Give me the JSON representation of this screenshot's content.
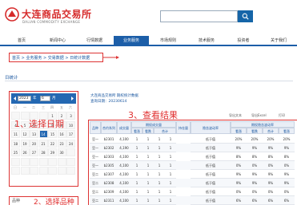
{
  "header": {
    "logo_cn": "大连商品交易所",
    "logo_en": "DALIAN COMMODITY EXCHANGE"
  },
  "nav": {
    "items": [
      "首页",
      "新闻中心",
      "行情数据",
      "业务服务",
      "市场规则",
      "技术服务",
      "投资者",
      "关于我们"
    ],
    "active_index": 3
  },
  "breadcrumb": {
    "text": "首页 > 业务服务 > 交易数据 > 日统计数据"
  },
  "section": {
    "title": "日统计"
  },
  "calendar": {
    "year": "2023",
    "year_unit": "年",
    "month": "6",
    "month_unit": "月",
    "weekdays": [
      "日",
      "一",
      "二",
      "三",
      "四",
      "五",
      "六"
    ],
    "days": [
      "",
      "",
      "",
      "",
      "1",
      "2",
      "3",
      "4",
      "5",
      "6",
      "7",
      "8",
      "9",
      "10",
      "11",
      "12",
      "13",
      "14",
      "15",
      "16",
      "17",
      "18",
      "19",
      "20",
      "21",
      "22",
      "23",
      "24",
      "25",
      "26",
      "27",
      "28",
      "29",
      "30",
      "",
      "",
      "",
      "",
      "",
      "",
      "",
      "",
      "",
      "",
      "",
      "",
      "",
      "",
      ""
    ],
    "selected_day": "14",
    "annotation": "1、选择日期"
  },
  "variety": {
    "label": "品种",
    "annotation": "2、选择品种"
  },
  "result": {
    "info_line1": "大连商品交易所 期权统计数据",
    "info_line2": "查询日期：20230614",
    "annotation": "3、查看结果",
    "tools": [
      "导出文本",
      "导出Excel",
      "打印"
    ],
    "headers_top": [
      "品种",
      "合约系列",
      "成交量",
      "成交量",
      "持仓量",
      "行权量",
      "隐含波动率",
      "隐含波动率"
    ],
    "group_title_left": "期权成交量",
    "group_title_right": "期权隐含波动率",
    "sub_headers": [
      "看涨",
      "看跌",
      "合计",
      "看涨",
      "看跌",
      "合计",
      "看涨",
      "看跌",
      "合计"
    ],
    "rows": [
      [
        "豆一",
        "b2301",
        "4,100",
        "1",
        "1",
        "1",
        "1",
        "低于值",
        "20%",
        "20%",
        "20%",
        "20%"
      ],
      [
        "豆一",
        "b2302",
        "4,190",
        "1",
        "1",
        "1",
        "1",
        "低于值",
        "9%",
        "9%",
        "9%",
        "9%"
      ],
      [
        "豆一",
        "b2303",
        "4,100",
        "1",
        "1",
        "1",
        "1",
        "低于值",
        "8%",
        "8%",
        "8%",
        "8%"
      ],
      [
        "豆一",
        "b2305",
        "4,100",
        "1",
        "1",
        "1",
        "1",
        "低于值",
        "0%",
        "0%",
        "0%",
        "0%"
      ],
      [
        "豆二",
        "b2307",
        "4,100",
        "1",
        "1",
        "1",
        "1",
        "低于值",
        "9%",
        "9%",
        "9%",
        "9%"
      ],
      [
        "豆二",
        "b2308",
        "4,100",
        "1",
        "1",
        "1",
        "1",
        "低于值",
        "9%",
        "9%",
        "9%",
        "9%"
      ],
      [
        "豆二",
        "b2309",
        "4,100",
        "1",
        "1",
        "1",
        "1",
        "低于值",
        "0%",
        "0%",
        "0%",
        "0%"
      ],
      [
        "豆二",
        "b2311",
        "4,100",
        "1",
        "1",
        "1",
        "1",
        "低于值",
        "6%",
        "6%",
        "6%",
        "6%"
      ]
    ]
  },
  "colors": {
    "accent": "#1c5ea8",
    "annotation": "#e03030",
    "logo": "#d62a2a"
  }
}
